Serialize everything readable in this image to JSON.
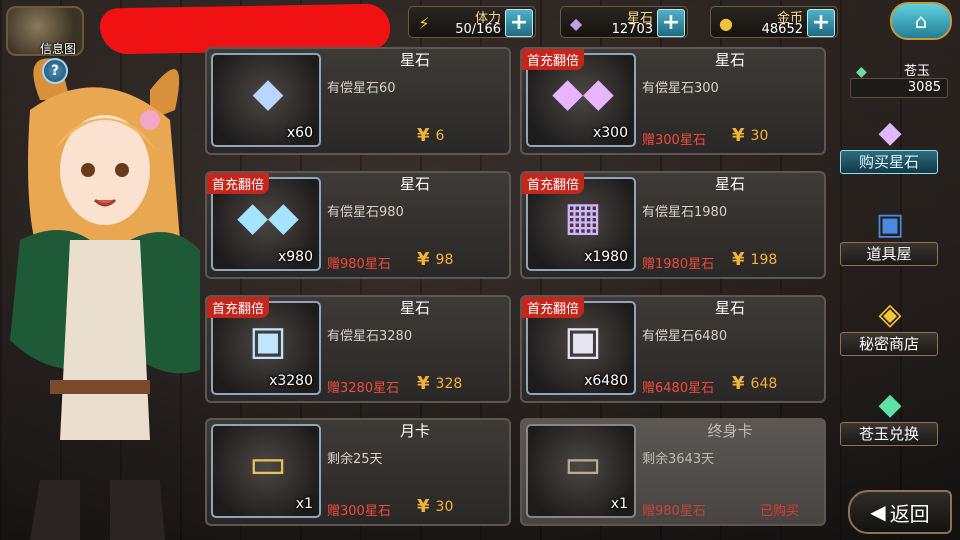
{
  "header": {
    "news_label": "信息图",
    "help_symbol": "?",
    "stamina": {
      "label": "体力",
      "value": "50/166",
      "icon": "lightning-icon"
    },
    "star_stones": {
      "label": "星石",
      "value": "12703",
      "icon": "crystal-icon"
    },
    "gold": {
      "label": "金币",
      "value": "48652",
      "icon": "coin-icon"
    },
    "plus_symbol": "+",
    "home_icon": "home-icon"
  },
  "cards": [
    {
      "title": "星石",
      "desc": "有偿星石60",
      "qty": "x60",
      "badge": "",
      "bonus": "",
      "price": "6",
      "currency": "¥"
    },
    {
      "title": "星石",
      "desc": "有偿星石300",
      "qty": "x300",
      "badge": "首充翻倍",
      "bonus": "赠300星石",
      "price": "30",
      "currency": "¥"
    },
    {
      "title": "星石",
      "desc": "有偿星石980",
      "qty": "x980",
      "badge": "首充翻倍",
      "bonus": "赠980星石",
      "price": "98",
      "currency": "¥"
    },
    {
      "title": "星石",
      "desc": "有偿星石1980",
      "qty": "x1980",
      "badge": "首充翻倍",
      "bonus": "赠1980星石",
      "price": "198",
      "currency": "¥"
    },
    {
      "title": "星石",
      "desc": "有偿星石3280",
      "qty": "x3280",
      "badge": "首充翻倍",
      "bonus": "赠3280星石",
      "price": "328",
      "currency": "¥"
    },
    {
      "title": "星石",
      "desc": "有偿星石6480",
      "qty": "x6480",
      "badge": "首充翻倍",
      "bonus": "赠6480星石",
      "price": "648",
      "currency": "¥"
    },
    {
      "title": "月卡",
      "desc": "剩余25天",
      "qty": "x1",
      "badge": "",
      "bonus": "赠300星石",
      "price": "30",
      "currency": "¥"
    },
    {
      "title": "终身卡",
      "desc": "剩余3643天",
      "qty": "x1",
      "badge": "",
      "bonus": "赠980星石",
      "price": "",
      "currency": "",
      "status": "已购买"
    }
  ],
  "sidebar": {
    "cangyu_label": "苍玉",
    "cangyu_value": "3085",
    "items": [
      {
        "label": "购买星石",
        "icon": "crystal-bundle-icon",
        "active": true
      },
      {
        "label": "道具屋",
        "icon": "item-box-icon",
        "active": false
      },
      {
        "label": "秘密商店",
        "icon": "treasure-pile-icon",
        "active": false
      },
      {
        "label": "苍玉兑换",
        "icon": "green-crystal-icon",
        "active": false
      }
    ],
    "back_label": "返回"
  },
  "colors": {
    "accent": "#4fb2c8",
    "price": "#f3b33b",
    "bonus": "#f04a3a",
    "badge": "#c4261c"
  }
}
